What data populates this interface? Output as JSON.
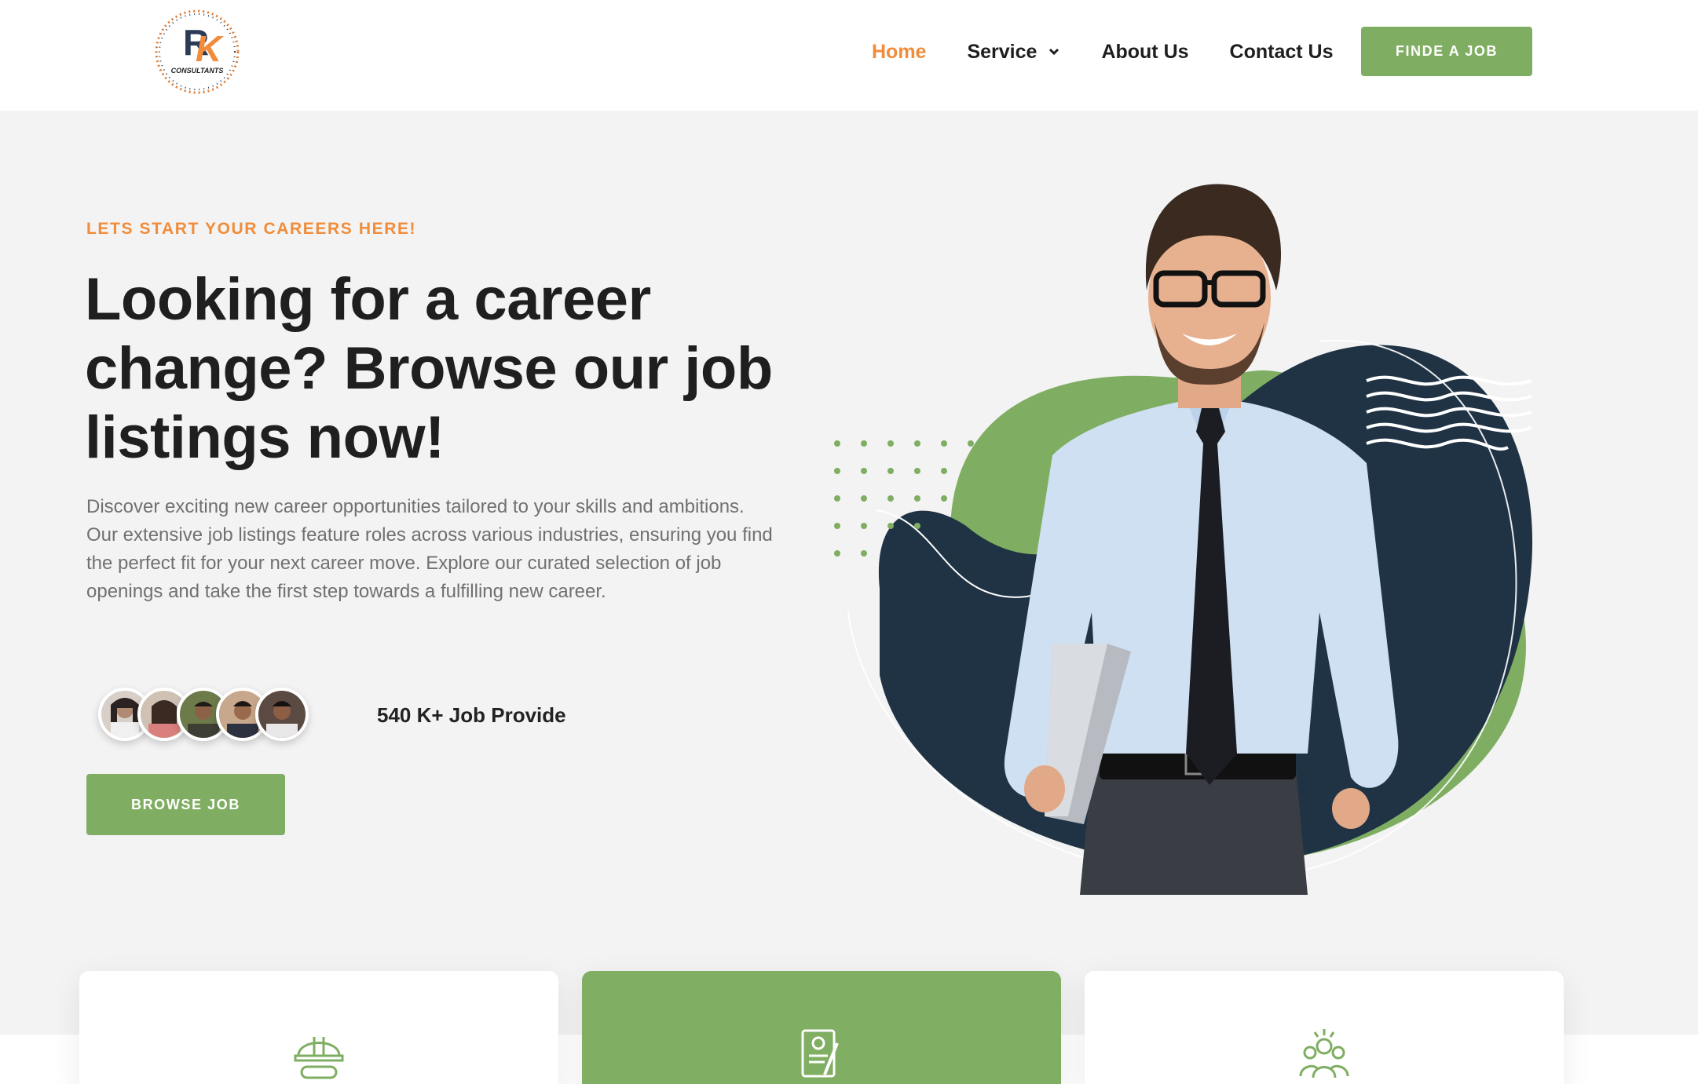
{
  "logo": {
    "text": "CONSULTANTS",
    "letters": "RK"
  },
  "nav": {
    "items": [
      {
        "label": "Home",
        "active": true
      },
      {
        "label": "Service",
        "dropdown": true
      },
      {
        "label": "About Us"
      },
      {
        "label": "Contact Us"
      }
    ],
    "cta": "FINDE A JOB"
  },
  "hero": {
    "eyebrow": "LETS START YOUR CAREERS HERE!",
    "title": "Looking for a career change? Browse our job listings now!",
    "description": "Discover exciting new career opportunities tailored to your skills and ambitions. Our extensive job listings feature roles across various industries, ensuring you find the perfect fit for your next career move. Explore our curated selection of job openings and take the first step towards a fulfilling new career.",
    "job_count": "540 K+ Job Provide",
    "browse_label": "BROWSE JOB"
  },
  "cards": [
    {
      "icon": "safety-helmet-icon"
    },
    {
      "icon": "resume-document-icon"
    },
    {
      "icon": "team-people-icon"
    }
  ],
  "colors": {
    "accent_orange": "#f08c3a",
    "brand_green": "#7fae62",
    "navy": "#1f3345",
    "background": "#f3f3f3"
  }
}
